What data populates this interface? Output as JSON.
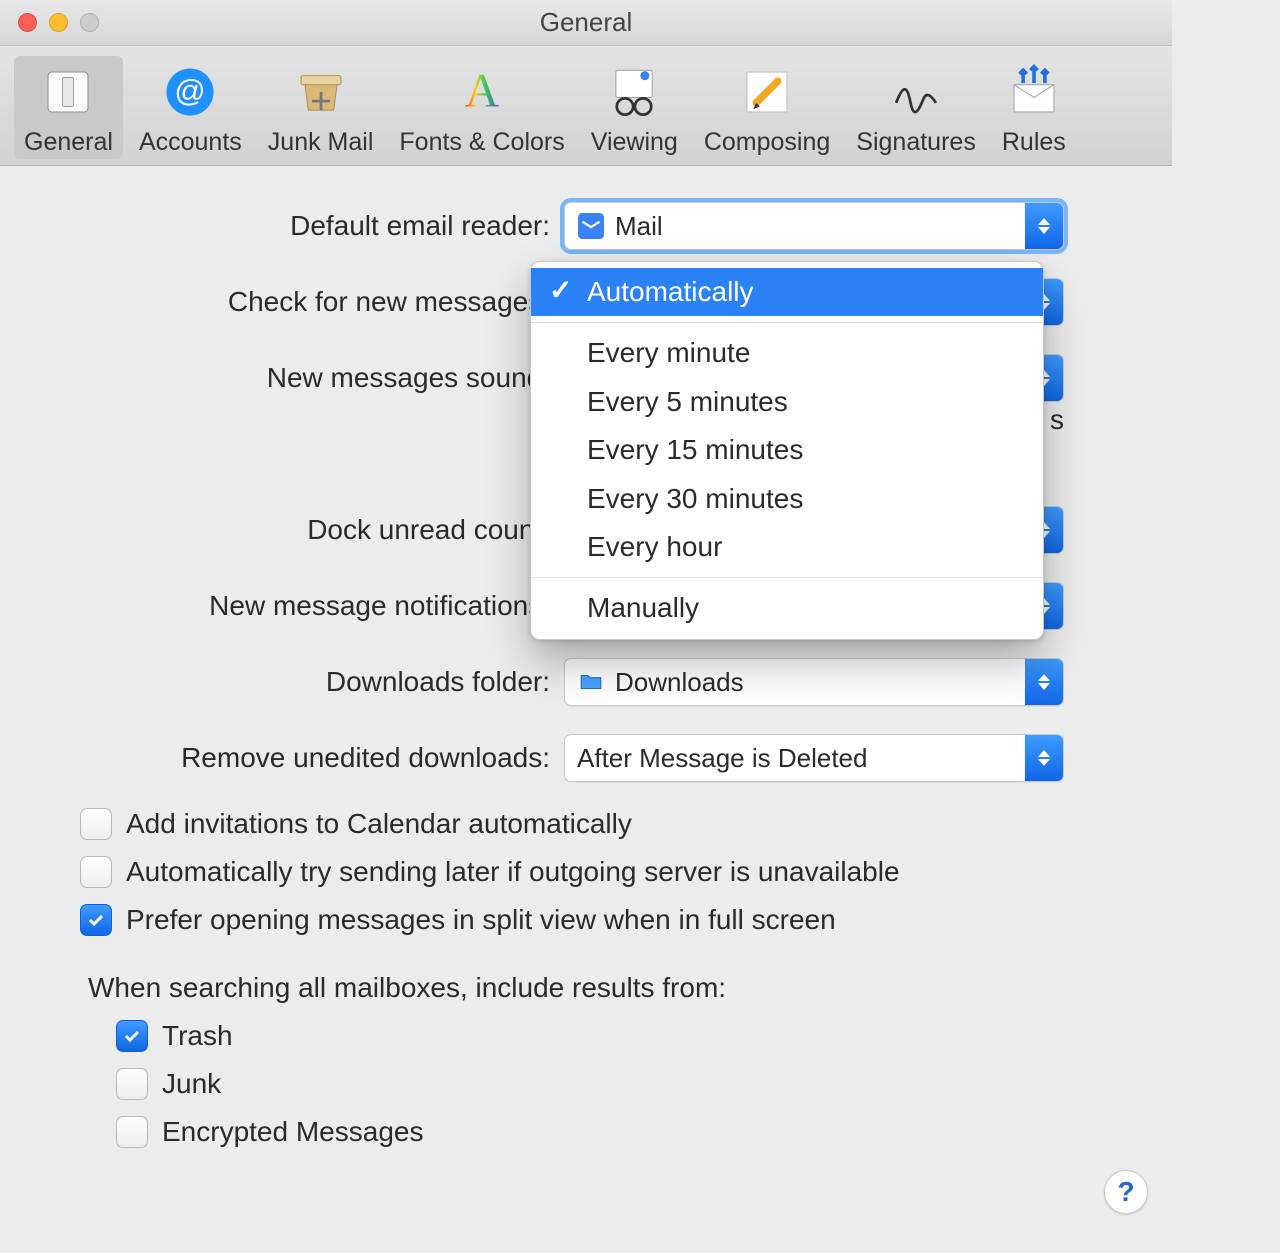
{
  "window": {
    "title": "General"
  },
  "toolbar": [
    {
      "id": "general",
      "label": "General",
      "selected": true
    },
    {
      "id": "accounts",
      "label": "Accounts",
      "selected": false
    },
    {
      "id": "junk",
      "label": "Junk Mail",
      "selected": false
    },
    {
      "id": "fonts",
      "label": "Fonts & Colors",
      "selected": false
    },
    {
      "id": "viewing",
      "label": "Viewing",
      "selected": false
    },
    {
      "id": "composing",
      "label": "Composing",
      "selected": false
    },
    {
      "id": "signatures",
      "label": "Signatures",
      "selected": false
    },
    {
      "id": "rules",
      "label": "Rules",
      "selected": false
    }
  ],
  "form": {
    "default_reader": {
      "label": "Default email reader:",
      "value": "Mail"
    },
    "check_messages": {
      "label": "Check for new messages:",
      "value": "Automatically"
    },
    "sound": {
      "label": "New messages sound:"
    },
    "dock": {
      "label": "Dock unread count:"
    },
    "notifications": {
      "label": "New message notifications:"
    },
    "downloads": {
      "label": "Downloads folder:",
      "value": "Downloads"
    },
    "remove_downloads": {
      "label": "Remove unedited downloads:",
      "value": "After Message is Deleted"
    }
  },
  "check_menu": {
    "selected": "Automatically",
    "groups": [
      [
        "Automatically"
      ],
      [
        "Every minute",
        "Every 5 minutes",
        "Every 15 minutes",
        "Every 30 minutes",
        "Every hour"
      ],
      [
        "Manually"
      ]
    ]
  },
  "checkboxes": {
    "invitations": {
      "label": "Add invitations to Calendar automatically",
      "checked": false
    },
    "retry": {
      "label": "Automatically try sending later if outgoing server is unavailable",
      "checked": false
    },
    "splitview": {
      "label": "Prefer opening messages in split view when in full screen",
      "checked": true
    }
  },
  "search_section": {
    "heading": "When searching all mailboxes, include results from:",
    "trash": {
      "label": "Trash",
      "checked": true
    },
    "junk": {
      "label": "Junk",
      "checked": false
    },
    "encrypted": {
      "label": "Encrypted Messages",
      "checked": false
    }
  },
  "help": {
    "label": "?"
  },
  "side_char": "s"
}
